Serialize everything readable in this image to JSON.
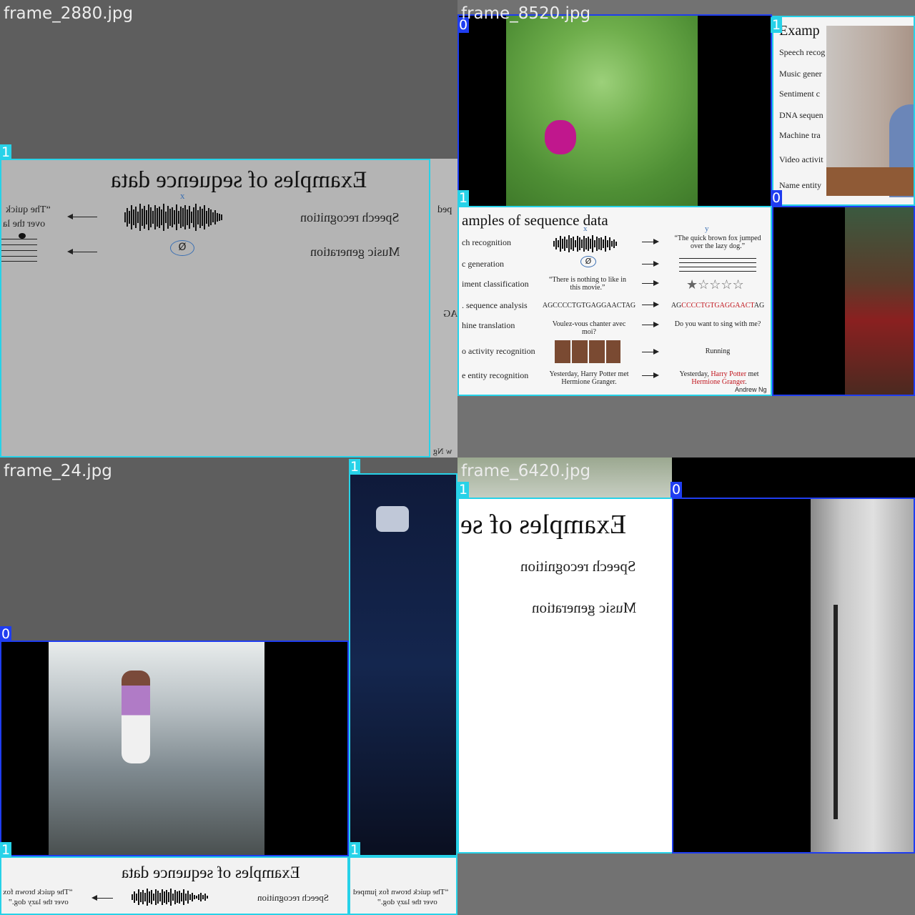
{
  "tiles": [
    {
      "filename": "frame_2880.jpg"
    },
    {
      "filename": "frame_8520.jpg"
    },
    {
      "filename": "frame_24.jpg"
    },
    {
      "filename": "frame_6420.jpg"
    }
  ],
  "class_ids": {
    "zero": "0",
    "one": "1"
  },
  "colors": {
    "class0_box": "#1f3df0",
    "class1_box": "#27d2e8",
    "background": "#727272"
  },
  "slide": {
    "title": "Examples of sequence data",
    "title_partial_left": "Examples of se",
    "title_partial_right": "amples of sequence data",
    "title_cut": "Examp",
    "rows": {
      "speech": "Speech recognition",
      "music": "Music generation",
      "sentiment": "Sentiment classification",
      "dna": "DNA sequence analysis",
      "translation": "Machine translation",
      "video": "Video activity recognition",
      "name": "Name entity recognition"
    },
    "rows_cut": {
      "speech": "ch recognition",
      "music": "c generation",
      "sentiment": "iment classification",
      "dna": ". sequence analysis",
      "translation": "hine translation",
      "video": "o activity recognition",
      "name": "e entity recognition"
    },
    "side_cut": {
      "speech": "Speech recog",
      "music": "Music gener",
      "sentiment": "Sentiment c",
      "dna": "DNA sequen",
      "translation": "Machine tra",
      "video": "Video activit",
      "name": "Name entity"
    },
    "quote_fox": "“The quick brown fox jumped over the lazy dog.”",
    "quote_fox_cut1": "“The quick",
    "quote_fox_cut2": "over the la",
    "quote_fox_cut3": "“The quick brown fox",
    "quote_fox_cut4": "over the lazy dog.”",
    "quote_fox_cut5": "“The quick brown fox jumped",
    "quote_fox_cut6": "over the lazy dog.”",
    "movie_quote": "“There is nothing to like in this movie.”",
    "dna_input": "AGCCCCTGTGAGGAACTAG",
    "dna_output_prefix": "AG",
    "dna_output_red": "CCCCTGTGAGGAACT",
    "dna_output_suffix": "AG",
    "french": "Voulez-vous chanter avec moi?",
    "english": "Do you want to sing with me?",
    "running": "Running",
    "ner_input": "Yesterday, Harry Potter met Hermione Granger.",
    "ner_out_a": "Yesterday, ",
    "ner_out_harry": "Harry Potter",
    "ner_out_b": "met ",
    "ner_out_hermione": "Hermione Granger",
    "ner_out_c": ".",
    "credit": "Andrew Ng",
    "credit_cut": "w Ng",
    "ann_x": "x",
    "ann_y": "y",
    "ann_null": "Ø",
    "ag_cut": "AG",
    "ped_cut": "ped",
    "stars": "★☆☆☆☆"
  }
}
